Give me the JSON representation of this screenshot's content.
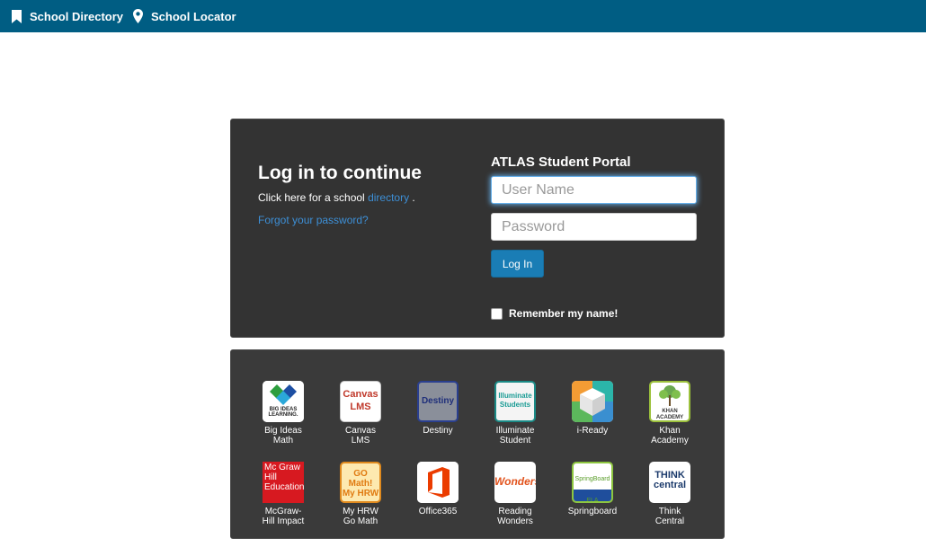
{
  "nav": {
    "school_directory": "School Directory",
    "school_locator": "School Locator"
  },
  "login": {
    "title": "Log in to continue",
    "note_prefix": "Click here for a school",
    "note_link": "directory",
    "note_suffix": ".",
    "forgot": "Forgot your password?",
    "portal_title": "ATLAS Student Portal",
    "username_placeholder": "User Name",
    "password_placeholder": "Password",
    "login_button": "Log In",
    "remember_label": "Remember my name!"
  },
  "apps": [
    {
      "label": "Big Ideas\nMath",
      "logo_text": "BIG IDEAS LEARNING."
    },
    {
      "label": "Canvas\nLMS",
      "logo_text": "Canvas LMS"
    },
    {
      "label": "Destiny",
      "logo_text": "Destiny"
    },
    {
      "label": "Illuminate\nStudent",
      "logo_text": "Illuminate Students"
    },
    {
      "label": "i-Ready",
      "logo_text": ""
    },
    {
      "label": "Khan\nAcademy",
      "logo_text": "KHAN ACADEMY"
    },
    {
      "label": "McGraw-\nHill Impact",
      "logo_text": "Mc Graw Hill Education"
    },
    {
      "label": "My HRW\nGo Math",
      "logo_text": "GO Math! My HRW"
    },
    {
      "label": "Office365",
      "logo_text": ""
    },
    {
      "label": "Reading\nWonders",
      "logo_text": "Wonders"
    },
    {
      "label": "Springboard",
      "logo_text": "SpringBoard ELA"
    },
    {
      "label": "Think\nCentral",
      "logo_text": "THINK central"
    }
  ],
  "colors": {
    "topbar": "#005d83",
    "panel": "#333333",
    "link": "#3d8fd6",
    "button": "#1a7db5"
  }
}
